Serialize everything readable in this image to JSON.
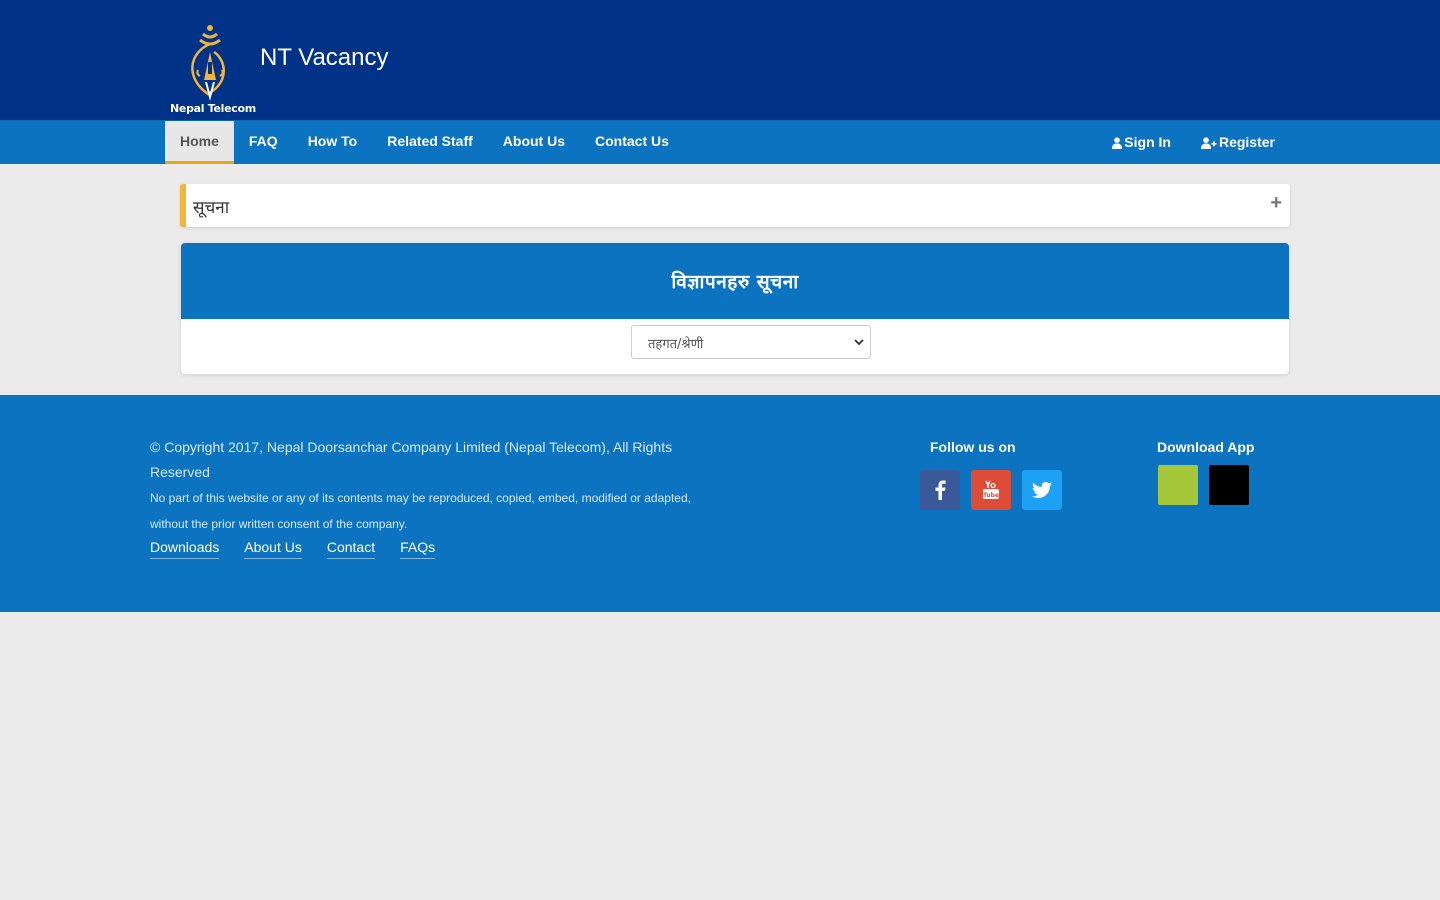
{
  "header": {
    "logo_text": "Nepal Telecom",
    "title": "NT Vacancy"
  },
  "nav": {
    "items": [
      {
        "label": "Home",
        "active": true
      },
      {
        "label": "FAQ"
      },
      {
        "label": "How To"
      },
      {
        "label": "Related Staff"
      },
      {
        "label": "About Us"
      },
      {
        "label": "Contact Us"
      }
    ],
    "sign_in": "Sign In",
    "register": "Register",
    "sign_in_icon": "user-icon",
    "register_icon": "user-plus-icon"
  },
  "notice": {
    "title": "सूचना",
    "toggle": "+"
  },
  "vacancy_panel": {
    "title": "विज्ञापनहरु सूचना",
    "select_value": "तहगत/श्रेणी"
  },
  "footer": {
    "copyright": "© Copyright 2017, Nepal Doorsanchar Company Limited (Nepal Telecom), All Rights Reserved",
    "disclaimer": "No part of this website or any of its contents may be reproduced, copied, embed, modified or adapted, without the prior written consent of the company.",
    "links": [
      "Downloads",
      "About Us",
      "Contact",
      "FAQs"
    ],
    "follow_title": "Follow us on",
    "social": [
      {
        "name": "facebook-icon",
        "color": "#3b5998"
      },
      {
        "name": "youtube-icon",
        "color": "#dd4b39"
      },
      {
        "name": "twitter-icon",
        "color": "#1da1f2"
      }
    ],
    "download_title": "Download App",
    "apps": [
      {
        "name": "android-app-button",
        "color": "#a4c639"
      },
      {
        "name": "ios-app-button",
        "color": "#000000"
      }
    ]
  },
  "colors": {
    "header_bg": "#003288",
    "nav_bg": "#0b73c0",
    "accent": "#f0a30a",
    "page_bg": "#ebebeb"
  }
}
